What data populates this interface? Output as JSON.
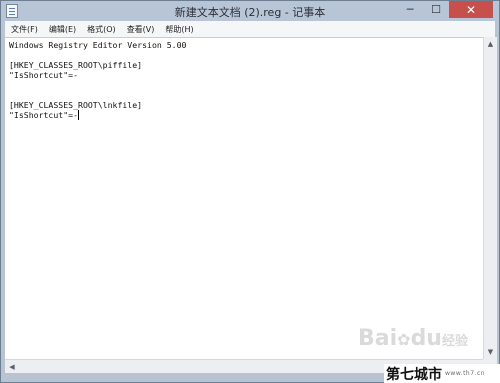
{
  "window": {
    "title": "新建文本文档 (2).reg - 记事本",
    "controls": {
      "minimize": "─",
      "maximize": "☐",
      "close": "✕"
    }
  },
  "menu": {
    "items": [
      {
        "label": "文件(F)"
      },
      {
        "label": "编辑(E)"
      },
      {
        "label": "格式(O)"
      },
      {
        "label": "查看(V)"
      },
      {
        "label": "帮助(H)"
      }
    ]
  },
  "editor": {
    "lines": [
      "Windows Registry Editor Version 5.00",
      "",
      "[HKEY_CLASSES_ROOT\\piffile]",
      "\"IsShortcut\"=-",
      "",
      "",
      "[HKEY_CLASSES_ROOT\\lnkfile]",
      "\"IsShortcut\"=-"
    ]
  },
  "scrollbars": {
    "up_arrow": "▲",
    "down_arrow": "▼",
    "left_arrow": "◀",
    "right_arrow": "▶"
  },
  "watermark": {
    "baidu_a": "Bai",
    "baidu_b": "du",
    "jingyan": "经验"
  },
  "site_logo": {
    "name": "第七城市",
    "url": "www.th7.cn"
  }
}
